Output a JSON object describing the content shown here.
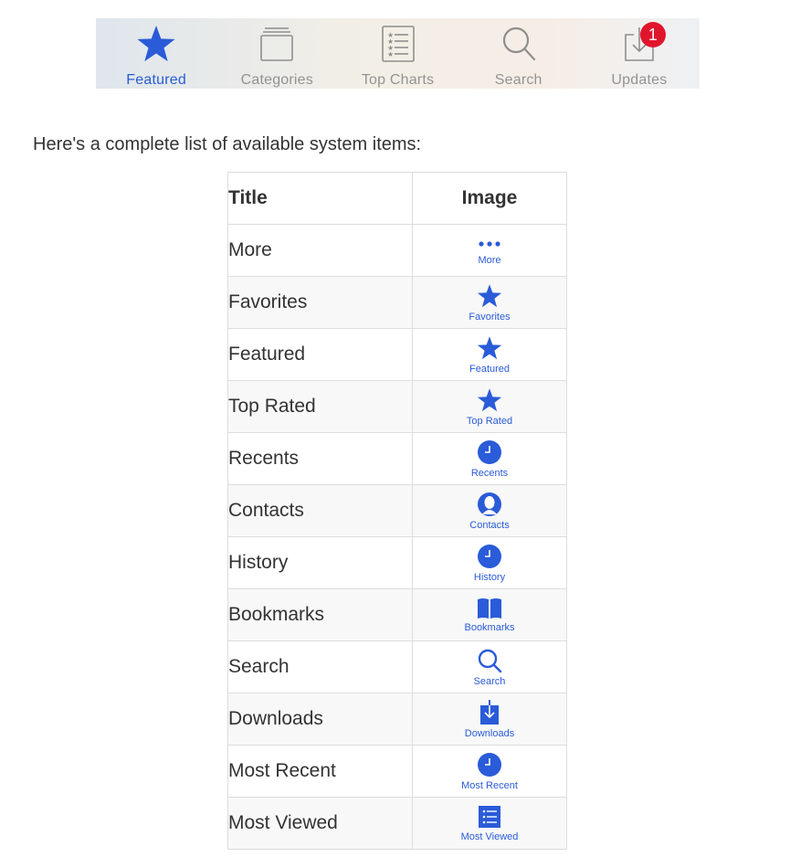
{
  "tabbar": {
    "tabs": [
      {
        "label": "Featured",
        "icon": "star-icon",
        "active": true
      },
      {
        "label": "Categories",
        "icon": "categories-icon",
        "active": false
      },
      {
        "label": "Top Charts",
        "icon": "list-icon",
        "active": false
      },
      {
        "label": "Search",
        "icon": "search-icon",
        "active": false
      },
      {
        "label": "Updates",
        "icon": "download-icon",
        "active": false,
        "badge": "1"
      }
    ],
    "active_color": "#2a5bd8",
    "inactive_color": "#939393",
    "badge_color": "#e0152c"
  },
  "intro": "Here's a complete list of available system items:",
  "table": {
    "headers": {
      "title": "Title",
      "image": "Image"
    },
    "rows": [
      {
        "title": "More",
        "label": "More",
        "icon": "more-icon"
      },
      {
        "title": "Favorites",
        "label": "Favorites",
        "icon": "star-icon"
      },
      {
        "title": "Featured",
        "label": "Featured",
        "icon": "star-icon"
      },
      {
        "title": "Top Rated",
        "label": "Top Rated",
        "icon": "star-icon"
      },
      {
        "title": "Recents",
        "label": "Recents",
        "icon": "clock-icon"
      },
      {
        "title": "Contacts",
        "label": "Contacts",
        "icon": "contact-icon"
      },
      {
        "title": "History",
        "label": "History",
        "icon": "clock-icon"
      },
      {
        "title": "Bookmarks",
        "label": "Bookmarks",
        "icon": "book-icon"
      },
      {
        "title": "Search",
        "label": "Search",
        "icon": "search-icon"
      },
      {
        "title": "Downloads",
        "label": "Downloads",
        "icon": "download-icon"
      },
      {
        "title": "Most Recent",
        "label": "Most Recent",
        "icon": "clock-icon"
      },
      {
        "title": "Most Viewed",
        "label": "Most Viewed",
        "icon": "list-icon"
      }
    ],
    "icon_color": "#2a5bd8"
  }
}
